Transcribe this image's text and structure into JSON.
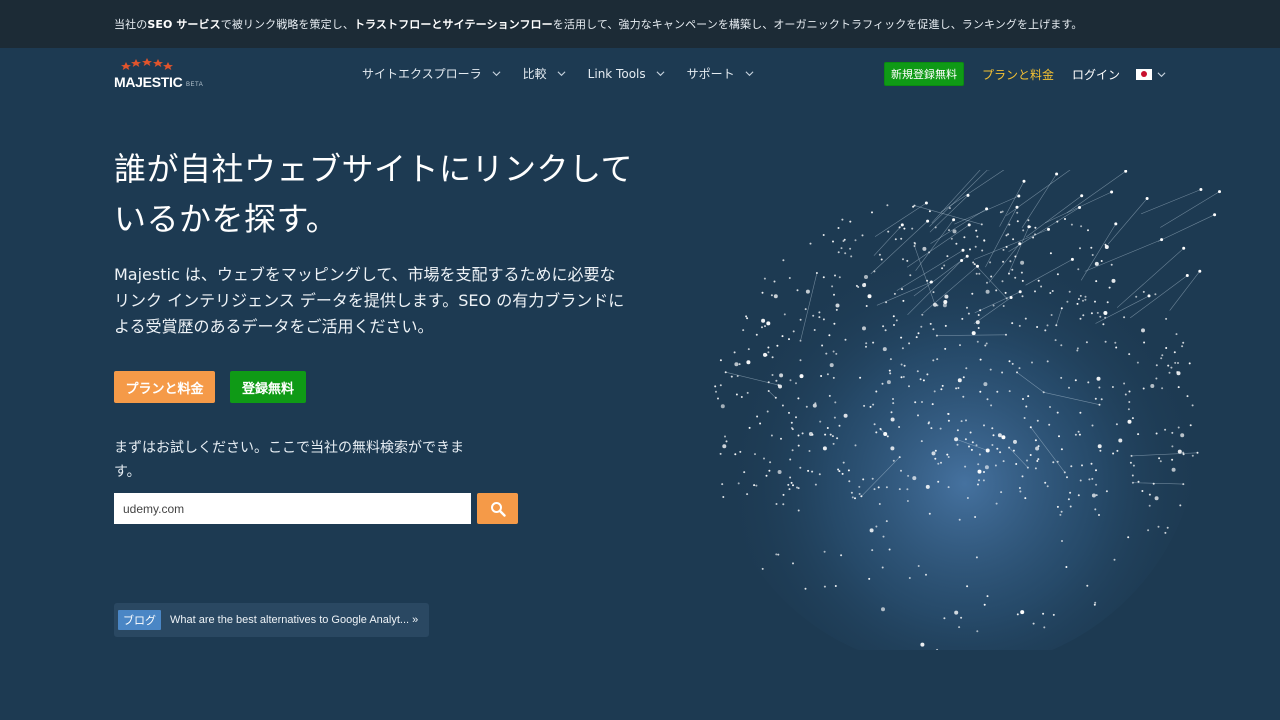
{
  "topbar": {
    "part1": "当社の ",
    "bold1": "SEO サービス",
    "part2": "で被リンク戦略を策定し、",
    "bold2": "トラストフローとサイテーションフロー",
    "part3": "を活用して、強力なキャンペーンを構築し、オーガニックトラフィックを促進し、ランキングを上げます。"
  },
  "logo": {
    "text": "MAJESTIC",
    "beta": "BETA"
  },
  "nav": {
    "items": [
      {
        "label": "サイトエクスプローラ"
      },
      {
        "label": "比較"
      },
      {
        "label": "Link Tools"
      },
      {
        "label": "サポート"
      }
    ],
    "signup_label": "新規登録無料",
    "plan_label": "プランと料金",
    "login_label": "ログイン"
  },
  "hero": {
    "title": "誰が自社ウェブサイトにリンクしているかを探す。",
    "description": "Majestic は、ウェブをマッピングして、市場を支配するために必要なリンク インテリジェンス データを提供します。SEO の有力ブランドによる受賞歴のあるデータをご活用ください。",
    "plan_button": "プランと料金",
    "signup_button": "登録無料",
    "try_text": "まずはお試しください。ここで当社の無料検索ができます。"
  },
  "search": {
    "value": "udemy.com"
  },
  "blog": {
    "tag": "ブログ",
    "link": "What are the best alternatives to Google Analyt... »"
  },
  "colors": {
    "background": "#1d3a52",
    "topbar": "#1c2b36",
    "orange": "#f59a48",
    "green": "#0f9a16",
    "plan_link": "#f3c033",
    "blog_tag": "#4a86c5"
  },
  "icons": [
    "stars-logo-icon",
    "chevron-down-icon",
    "japan-flag-icon",
    "search-icon",
    "globe-network-icon"
  ]
}
